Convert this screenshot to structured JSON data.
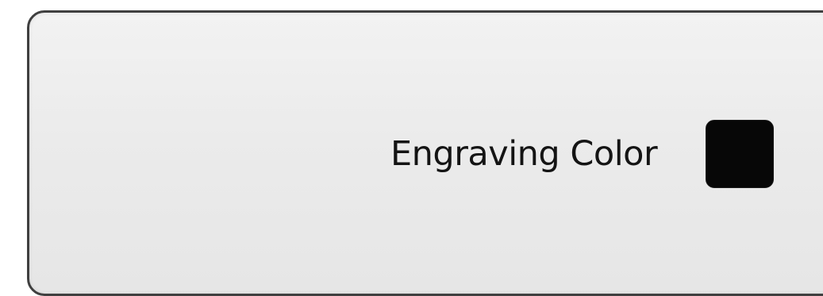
{
  "engraving": {
    "label": "Engraving Color",
    "selected_color": "#070707"
  }
}
